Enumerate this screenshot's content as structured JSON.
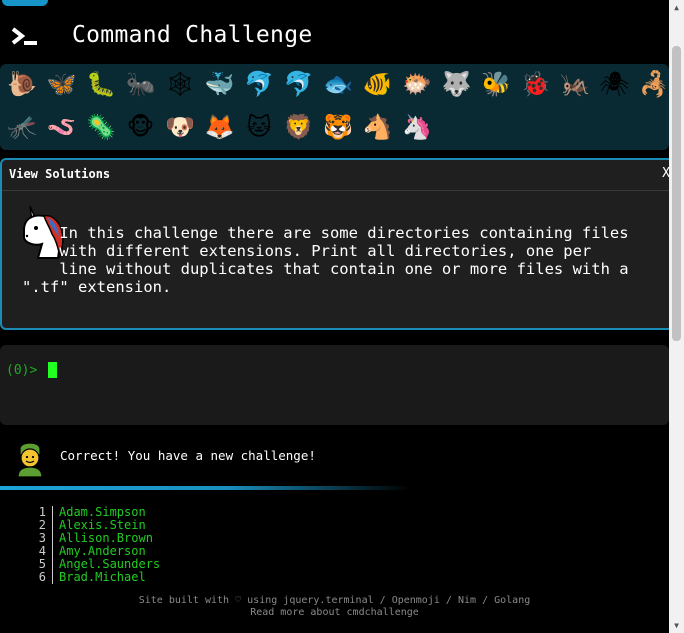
{
  "header": {
    "title": "Command Challenge",
    "logo_icon": "terminal-prompt-icon"
  },
  "emoji_bar": {
    "row1": [
      "🐌",
      "🦋",
      "🐛",
      "🐜",
      "🕸",
      "🐳",
      "🐬",
      "🐬",
      "🐟",
      "🐠",
      "🐡",
      "🐺",
      "🐝",
      "🐞",
      "🦗",
      "🕷",
      "🦂"
    ],
    "row2": [
      "🦟",
      "🪱",
      "🦠",
      "🐵",
      "🐶",
      "🦊",
      "🐱",
      "🦁",
      "🐯",
      "🐴",
      "🦄"
    ],
    "row1_names": [
      "snail-icon",
      "butterfly-icon",
      "caterpillar-icon",
      "ant-icon",
      "spider-web-icon",
      "whale-icon",
      "dolphin-icon",
      "dolphin-gray-icon",
      "fish-icon",
      "tropical-fish-icon",
      "blowfish-icon",
      "wolf-icon",
      "bee-icon",
      "ladybug-icon",
      "cricket-icon",
      "spider-icon",
      "scorpion-icon"
    ],
    "row2_names": [
      "mosquito-icon",
      "worm-icon",
      "microbe-icon",
      "monkey-icon",
      "dog-icon",
      "fox-icon",
      "cat-icon",
      "lion-icon",
      "tiger-icon",
      "horse-icon",
      "unicorn-icon"
    ]
  },
  "panel": {
    "title": "View Solutions",
    "close": "X",
    "challenge_text": "    In this challenge there are some directories containing files\n    with different extensions. Print all directories, one per\n    line without duplicates that contain one or more files with a\n\".tf\" extension."
  },
  "terminal": {
    "prompt": "(0)>"
  },
  "message": {
    "text": "Correct! You have a new challenge!"
  },
  "leaderboard": [
    {
      "rank": "1",
      "name": "Adam.Simpson"
    },
    {
      "rank": "2",
      "name": "Alexis.Stein"
    },
    {
      "rank": "3",
      "name": "Allison.Brown"
    },
    {
      "rank": "4",
      "name": "Amy.Anderson"
    },
    {
      "rank": "5",
      "name": "Angel.Saunders"
    },
    {
      "rank": "6",
      "name": "Brad.Michael"
    }
  ],
  "footer": {
    "site_built_with": "Site built with",
    "heart": "♡",
    "using": "using",
    "link_jquery": "jquery.terminal",
    "sep1": "/",
    "link_openmoji": "Openmoji",
    "sep2": "/",
    "link_nim": "Nim",
    "sep3": "/",
    "link_golang": "Golang",
    "read_more": "Read more about cmdchallenge"
  },
  "colors": {
    "accent": "#1a8bb5",
    "terminal_green": "#22ff22",
    "leaderboard_green": "#22cc22"
  }
}
